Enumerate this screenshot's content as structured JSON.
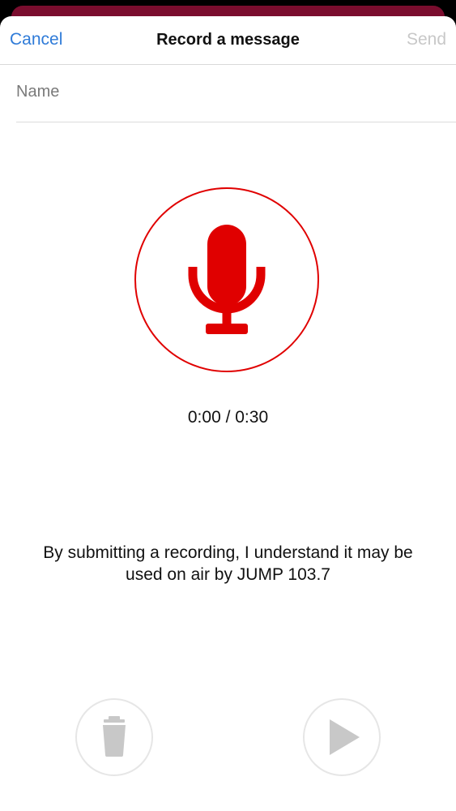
{
  "header": {
    "cancel_label": "Cancel",
    "title": "Record a message",
    "send_label": "Send"
  },
  "form": {
    "name_placeholder": "Name",
    "name_value": ""
  },
  "recorder": {
    "timer": "0:00 / 0:30",
    "record_icon": "microphone-icon",
    "elapsed_seconds": 0,
    "max_seconds": 30
  },
  "disclaimer": "By submitting a recording, I understand it may be used on air by JUMP 103.7",
  "controls": {
    "delete_icon": "trash-icon",
    "play_icon": "play-icon"
  },
  "colors": {
    "accent_red": "#e00000",
    "link_blue": "#2f7bd8",
    "disabled_gray": "#c8c8c8",
    "background_banner": "#7a0d2e"
  }
}
